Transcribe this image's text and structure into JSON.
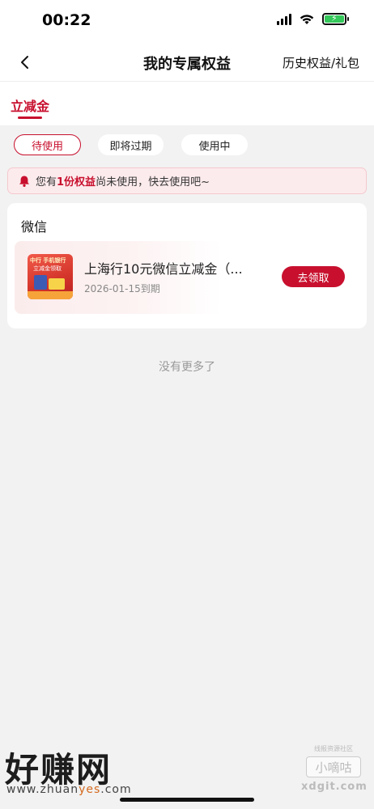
{
  "status_bar": {
    "time": "00:22",
    "icons": [
      "signal-icon",
      "wifi-icon",
      "battery-charging-icon"
    ],
    "battery_color": "#34c759"
  },
  "nav": {
    "back_icon": "chevron-left-icon",
    "title": "我的专属权益",
    "right_link": "历史权益/礼包"
  },
  "tabs": [
    {
      "label": "立减金",
      "active": true
    }
  ],
  "filters": [
    {
      "label": "待使用",
      "active": true
    },
    {
      "label": "即将过期",
      "active": false
    },
    {
      "label": "使用中",
      "active": false
    }
  ],
  "notice": {
    "icon": "bell-icon",
    "prefix": "您有",
    "highlight": "1份权益",
    "suffix": "尚未使用，快去使用吧~"
  },
  "section": {
    "title": "微信",
    "coupons": [
      {
        "thumb_text_1": "中行 手机银行",
        "thumb_text_2": "立减金领取",
        "name": "上海行10元微信立减金（...",
        "expiry": "2026-01-15到期",
        "action": "去领取"
      }
    ]
  },
  "footer_text": "没有更多了",
  "watermark": {
    "left_big": "好赚网",
    "left_url_1": "www.zhuan",
    "left_url_accent": "yes",
    "left_url_2": ".com",
    "right_small": "线报资源社区",
    "right_box": "小嘀咕",
    "right_domain": "xdgit.com"
  },
  "colors": {
    "accent": "#c8102e",
    "notice_bg": "#fcebed",
    "page_bg": "#f2f2f2"
  }
}
